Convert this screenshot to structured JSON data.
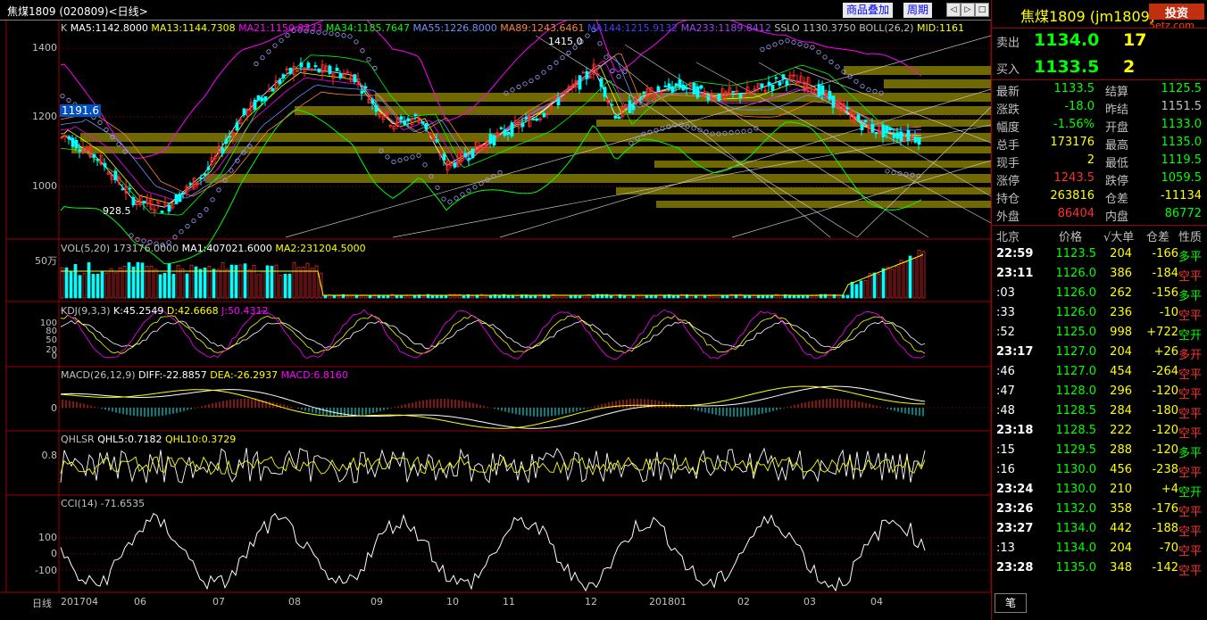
{
  "header": {
    "title": "焦煤1809 (020809)<日线>",
    "buttons": [
      "商品叠加",
      "周期"
    ],
    "arrows": [
      "◁",
      "▷",
      "□"
    ]
  },
  "main_chart": {
    "legend": [
      {
        "text": "K",
        "color": "#c0c0c0"
      },
      {
        "text": "MA5:1142.8000",
        "color": "#ffffff"
      },
      {
        "text": "MA13:1144.7308",
        "color": "#ffff00"
      },
      {
        "text": "MA21:1150.8333",
        "color": "#ff00ff"
      },
      {
        "text": "MA34:1185.7647",
        "color": "#00ff00"
      },
      {
        "text": "MA55:1226.8000",
        "color": "#6f8fff"
      },
      {
        "text": "MA89:1243.6461",
        "color": "#ff8040"
      },
      {
        "text": "MA144:1215.9132",
        "color": "#4040ff"
      },
      {
        "text": "MA233:1189.8412",
        "color": "#a040ff"
      },
      {
        "text": "SSLO 1130.3750",
        "color": "#c0c0c0"
      },
      {
        "text": "BOLL(26,2)",
        "color": "#c0c0c0"
      },
      {
        "text": "MID:1161",
        "color": "#ffff00"
      }
    ],
    "yticks": [
      "1400",
      "1200",
      "1000"
    ],
    "current_label": "1191.6",
    "high_label": "1415.0",
    "low_label": "928.5"
  },
  "vol_chart": {
    "legend": [
      {
        "text": "VOL(5,20) 173176.0000",
        "color": "#c0c0c0"
      },
      {
        "text": "MA1:407021.6000",
        "color": "#ffffff"
      },
      {
        "text": "MA2:231204.5000",
        "color": "#ffff00"
      }
    ],
    "yticks": [
      "50万"
    ]
  },
  "kdj_chart": {
    "legend": [
      {
        "text": "KDJ(9,3,3)",
        "color": "#c0c0c0"
      },
      {
        "text": "K:45.2549",
        "color": "#ffffff"
      },
      {
        "text": "D:42.6668",
        "color": "#ffff00"
      },
      {
        "text": "J:50.4312",
        "color": "#ff00ff"
      }
    ],
    "yticks": [
      "100",
      "80",
      "50",
      "20",
      "0"
    ]
  },
  "macd_chart": {
    "legend": [
      {
        "text": "MACD(26,12,9)",
        "color": "#c0c0c0"
      },
      {
        "text": "DIFF:-22.8857",
        "color": "#ffffff"
      },
      {
        "text": "DEA:-26.2937",
        "color": "#ffff00"
      },
      {
        "text": "MACD:6.8160",
        "color": "#ff00ff"
      }
    ],
    "yticks": [
      "0"
    ]
  },
  "qhlsr_chart": {
    "legend": [
      {
        "text": "QHLSR",
        "color": "#c0c0c0"
      },
      {
        "text": "QHL5:0.7182",
        "color": "#ffffff"
      },
      {
        "text": "QHL10:0.3729",
        "color": "#ffff00"
      }
    ],
    "yticks": [
      "0.8"
    ]
  },
  "cci_chart": {
    "legend": [
      {
        "text": "CCI(14) -71.6535",
        "color": "#c0c0c0"
      }
    ],
    "yticks": [
      "100",
      "0",
      "-100"
    ]
  },
  "xaxis": {
    "period_label": "日线",
    "labels": [
      "201704",
      "06",
      "07",
      "08",
      "09",
      "10",
      "11",
      "12",
      "201801",
      "02",
      "03",
      "04"
    ]
  },
  "right_panel": {
    "title": "焦煤1809 (jm1809)",
    "watermark": "投资",
    "watermark_sub": "5etz.com",
    "sell": {
      "label": "卖出",
      "price": "1134.0",
      "vol": "17"
    },
    "buy": {
      "label": "买入",
      "price": "1133.5",
      "vol": "2"
    },
    "stats": [
      {
        "l1": "最新",
        "v1": "1133.5",
        "c1": "#00ff00",
        "l2": "结算",
        "v2": "1125.5",
        "c2": "#00ff00"
      },
      {
        "l1": "涨跌",
        "v1": "-18.0",
        "c1": "#00ff00",
        "l2": "昨结",
        "v2": "1151.5",
        "c2": "#c0c0c0"
      },
      {
        "l1": "幅度",
        "v1": "-1.56%",
        "c1": "#00ff00",
        "l2": "开盘",
        "v2": "1133.0",
        "c2": "#00ff00"
      },
      {
        "l1": "总手",
        "v1": "173176",
        "c1": "#ffff00",
        "l2": "最高",
        "v2": "1135.0",
        "c2": "#00ff00"
      },
      {
        "l1": "现手",
        "v1": "2",
        "c1": "#ffff00",
        "l2": "最低",
        "v2": "1119.5",
        "c2": "#00ff00"
      },
      {
        "l1": "涨停",
        "v1": "1243.5",
        "c1": "#ff3030",
        "l2": "跌停",
        "v2": "1059.5",
        "c2": "#00ff00"
      },
      {
        "l1": "持仓",
        "v1": "263816",
        "c1": "#ffff00",
        "l2": "仓差",
        "v2": "-11134",
        "c2": "#ffff00"
      },
      {
        "l1": "外盘",
        "v1": "86404",
        "c1": "#ff3030",
        "l2": "内盘",
        "v2": "86772",
        "c2": "#00ff00"
      }
    ],
    "tick_header": {
      "time": "北京",
      "price": "价格",
      "vol": "√大单",
      "diff": "仓差",
      "nature": "性质"
    },
    "ticks": [
      {
        "time": "22:59",
        "price": "1123.5",
        "vol": "204",
        "diff": "-166",
        "nature": "多平",
        "nc": "#00ff00"
      },
      {
        "time": "23:11",
        "price": "1126.0",
        "vol": "386",
        "diff": "-184",
        "nature": "空平",
        "nc": "#ff3030"
      },
      {
        "time": ":03",
        "price": "1126.0",
        "vol": "262",
        "diff": "-156",
        "nature": "多平",
        "nc": "#00ff00"
      },
      {
        "time": ":33",
        "price": "1126.0",
        "vol": "236",
        "diff": "-10",
        "nature": "空平",
        "nc": "#ff3030"
      },
      {
        "time": ":52",
        "price": "1125.0",
        "vol": "998",
        "diff": "+722",
        "nature": "空开",
        "nc": "#00ff00"
      },
      {
        "time": "23:17",
        "price": "1127.0",
        "vol": "204",
        "diff": "+26",
        "nature": "多开",
        "nc": "#ff3030"
      },
      {
        "time": ":46",
        "price": "1127.0",
        "vol": "454",
        "diff": "-264",
        "nature": "空平",
        "nc": "#ff3030"
      },
      {
        "time": ":47",
        "price": "1128.0",
        "vol": "296",
        "diff": "-120",
        "nature": "空平",
        "nc": "#ff3030"
      },
      {
        "time": ":48",
        "price": "1128.5",
        "vol": "284",
        "diff": "-180",
        "nature": "空平",
        "nc": "#ff3030"
      },
      {
        "time": "23:18",
        "price": "1128.5",
        "vol": "222",
        "diff": "-120",
        "nature": "空平",
        "nc": "#ff3030"
      },
      {
        "time": ":15",
        "price": "1129.5",
        "vol": "288",
        "diff": "-120",
        "nature": "多平",
        "nc": "#00ff00"
      },
      {
        "time": ":16",
        "price": "1130.0",
        "vol": "456",
        "diff": "-238",
        "nature": "空平",
        "nc": "#ff3030"
      },
      {
        "time": "23:24",
        "price": "1130.0",
        "vol": "210",
        "diff": "+4",
        "nature": "空开",
        "nc": "#00ff00"
      },
      {
        "time": "23:26",
        "price": "1132.0",
        "vol": "358",
        "diff": "-176",
        "nature": "空平",
        "nc": "#ff3030"
      },
      {
        "time": "23:27",
        "price": "1134.0",
        "vol": "442",
        "diff": "-188",
        "nature": "空平",
        "nc": "#ff3030"
      },
      {
        "time": ":13",
        "price": "1134.0",
        "vol": "204",
        "diff": "-70",
        "nature": "空平",
        "nc": "#ff3030"
      },
      {
        "time": "23:28",
        "price": "1135.0",
        "vol": "348",
        "diff": "-142",
        "nature": "空平",
        "nc": "#ff3030"
      }
    ],
    "tab": "笔"
  },
  "colors": {
    "up": "#ff3030",
    "down": "#00ffff",
    "grid": "#a00000",
    "band": "#706800"
  }
}
